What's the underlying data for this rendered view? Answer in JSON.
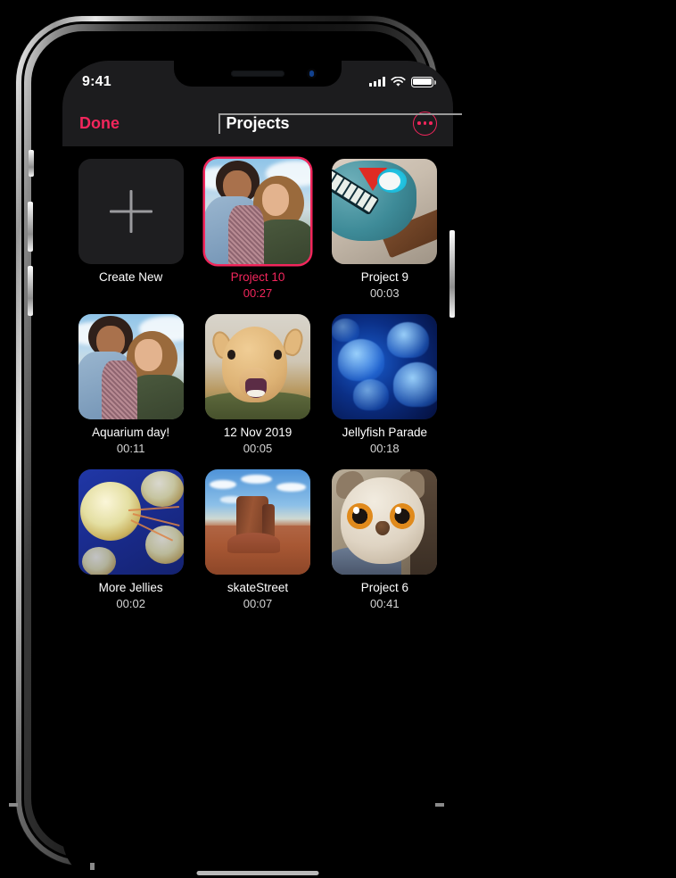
{
  "status_bar": {
    "time": "9:41",
    "cellular_icon": "signal-bars-icon",
    "wifi_icon": "wifi-icon",
    "battery_icon": "battery-full-icon"
  },
  "nav_bar": {
    "done_label": "Done",
    "title": "Projects",
    "more_icon": "more-ellipsis-icon"
  },
  "colors": {
    "accent": "#f2265c",
    "nav_background": "#1c1c1e",
    "screen_background": "#000000",
    "caption": "#ffffff",
    "duration": "#d6d6d6"
  },
  "create_new": {
    "label": "Create New",
    "icon": "plus-icon"
  },
  "projects": [
    {
      "name": "Project 10",
      "duration": "00:27",
      "selected": true,
      "art": "girls"
    },
    {
      "name": "Project 9",
      "duration": "00:03",
      "selected": false,
      "art": "robot"
    },
    {
      "name": "Aquarium day!",
      "duration": "00:11",
      "selected": false,
      "art": "girls"
    },
    {
      "name": "12 Nov 2019",
      "duration": "00:05",
      "selected": false,
      "art": "camel"
    },
    {
      "name": "Jellyfish Parade",
      "duration": "00:18",
      "selected": false,
      "art": "jelly-b"
    },
    {
      "name": "More Jellies",
      "duration": "00:02",
      "selected": false,
      "art": "jelly-g"
    },
    {
      "name": "skateStreet",
      "duration": "00:07",
      "selected": false,
      "art": "desert"
    },
    {
      "name": "Project 6",
      "duration": "00:41",
      "selected": false,
      "art": "owl"
    }
  ],
  "device": {
    "home_indicator": "home-indicator",
    "notch_speaker": "earpiece-speaker",
    "notch_camera": "front-camera",
    "mute_switch": "mute-switch-button",
    "volume_up": "volume-up-button",
    "volume_down": "volume-down-button",
    "power": "power-button"
  },
  "annotation": {
    "callout_target": "Project 10 thumbnail"
  }
}
